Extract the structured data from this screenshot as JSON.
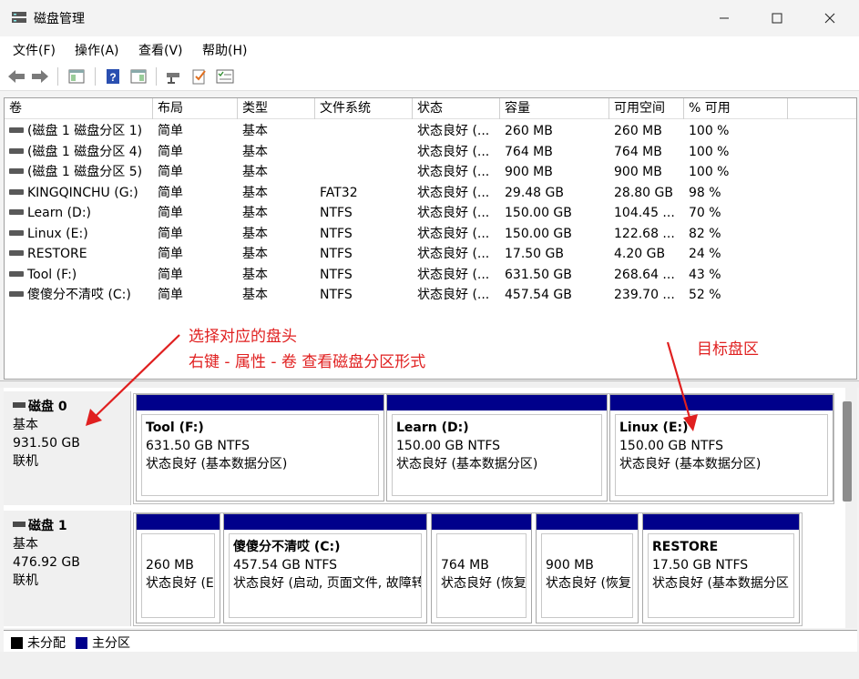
{
  "window": {
    "title": "磁盘管理"
  },
  "menu": [
    "文件(F)",
    "操作(A)",
    "查看(V)",
    "帮助(H)"
  ],
  "columns": [
    "卷",
    "布局",
    "类型",
    "文件系统",
    "状态",
    "容量",
    "可用空间",
    "% 可用"
  ],
  "volumes": [
    {
      "name": "(磁盘 1 磁盘分区 1)",
      "layout": "简单",
      "type": "基本",
      "fs": "",
      "status": "状态良好 (...",
      "capacity": "260 MB",
      "free": "260 MB",
      "pct": "100 %"
    },
    {
      "name": "(磁盘 1 磁盘分区 4)",
      "layout": "简单",
      "type": "基本",
      "fs": "",
      "status": "状态良好 (...",
      "capacity": "764 MB",
      "free": "764 MB",
      "pct": "100 %"
    },
    {
      "name": "(磁盘 1 磁盘分区 5)",
      "layout": "简单",
      "type": "基本",
      "fs": "",
      "status": "状态良好 (...",
      "capacity": "900 MB",
      "free": "900 MB",
      "pct": "100 %"
    },
    {
      "name": "KINGQINCHU (G:)",
      "layout": "简单",
      "type": "基本",
      "fs": "FAT32",
      "status": "状态良好 (...",
      "capacity": "29.48 GB",
      "free": "28.80 GB",
      "pct": "98 %"
    },
    {
      "name": "Learn (D:)",
      "layout": "简单",
      "type": "基本",
      "fs": "NTFS",
      "status": "状态良好 (...",
      "capacity": "150.00 GB",
      "free": "104.45 ...",
      "pct": "70 %"
    },
    {
      "name": "Linux (E:)",
      "layout": "简单",
      "type": "基本",
      "fs": "NTFS",
      "status": "状态良好 (...",
      "capacity": "150.00 GB",
      "free": "122.68 ...",
      "pct": "82 %"
    },
    {
      "name": "RESTORE",
      "layout": "简单",
      "type": "基本",
      "fs": "NTFS",
      "status": "状态良好 (...",
      "capacity": "17.50 GB",
      "free": "4.20 GB",
      "pct": "24 %"
    },
    {
      "name": "Tool (F:)",
      "layout": "简单",
      "type": "基本",
      "fs": "NTFS",
      "status": "状态良好 (...",
      "capacity": "631.50 GB",
      "free": "268.64 ...",
      "pct": "43 %"
    },
    {
      "name": "傻傻分不清哎 (C:)",
      "layout": "简单",
      "type": "基本",
      "fs": "NTFS",
      "status": "状态良好 (...",
      "capacity": "457.54 GB",
      "free": "239.70 ...",
      "pct": "52 %"
    }
  ],
  "disks": [
    {
      "name": "磁盘 0",
      "kind": "基本",
      "size": "931.50 GB",
      "state": "联机",
      "partitions": [
        {
          "name": "Tool  (F:)",
          "size": "631.50 GB NTFS",
          "status": "状态良好 (基本数据分区)"
        },
        {
          "name": "Learn  (D:)",
          "size": "150.00 GB NTFS",
          "status": "状态良好 (基本数据分区)"
        },
        {
          "name": "Linux  (E:)",
          "size": "150.00 GB NTFS",
          "status": "状态良好 (基本数据分区)"
        }
      ]
    },
    {
      "name": "磁盘 1",
      "kind": "基本",
      "size": "476.92 GB",
      "state": "联机",
      "partitions": [
        {
          "name": "",
          "size": "260 MB",
          "status": "状态良好 (E"
        },
        {
          "name": "傻傻分不清哎 (C:)",
          "size": "457.54 GB NTFS",
          "status": "状态良好 (启动, 页面文件, 故障转"
        },
        {
          "name": "",
          "size": "764 MB",
          "status": "状态良好 (恢复"
        },
        {
          "name": "",
          "size": "900 MB",
          "status": "状态良好 (恢复"
        },
        {
          "name": "RESTORE",
          "size": "17.50 GB NTFS",
          "status": "状态良好 (基本数据分区"
        }
      ]
    }
  ],
  "legend": [
    {
      "label": "未分配",
      "color": "#000000"
    },
    {
      "label": "主分区",
      "color": "#00008b"
    }
  ],
  "annotations": {
    "line1": "选择对应的盘头",
    "line2": "右键 - 属性 - 卷 查看磁盘分区形式",
    "target": "目标盘区",
    "color": "#e02020"
  }
}
